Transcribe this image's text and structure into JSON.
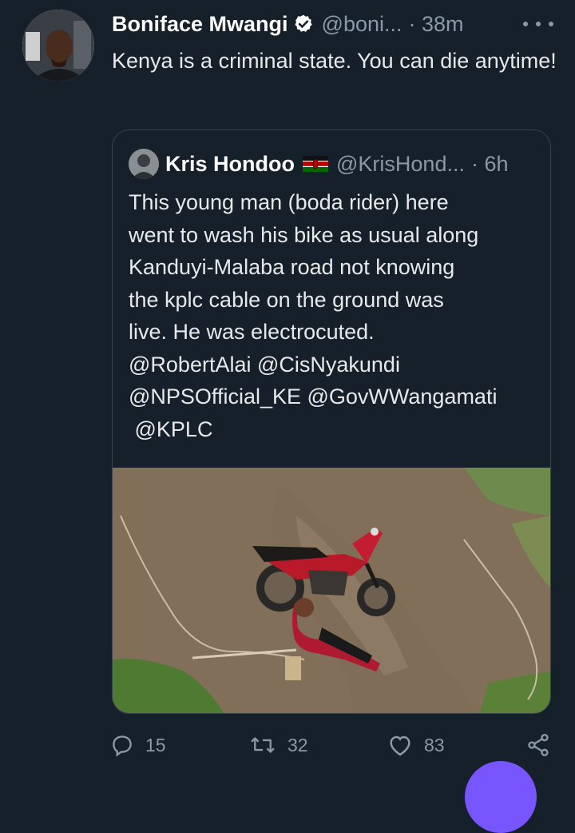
{
  "tweet": {
    "author_name": "Boniface Mwangi",
    "author_handle": "@boni...",
    "time": "· 38m",
    "text": "Kenya is a criminal state. You can die anytime!",
    "replies": "15",
    "retweets": "32",
    "likes": "83"
  },
  "quoted": {
    "author_name": "Kris Hondoo",
    "author_handle": "@KrisHond...",
    "time": "· 6h",
    "lines": [
      "This young man (boda rider) here",
      "went to wash his bike as usual along",
      "Kanduyi-Malaba road not knowing",
      "the kplc cable on the ground was",
      "live. He was electrocuted.",
      "@RobertAlai @CisNyakundi",
      "@NPSOfficial_KE @GovWWangamati",
      " @KPLC"
    ]
  },
  "icons": {
    "verified": "verified-badge-icon",
    "more": "more-options-icon",
    "flag": "kenya-flag-icon",
    "reply": "reply-icon",
    "retweet": "retweet-icon",
    "like": "heart-icon",
    "share": "share-icon"
  },
  "colors": {
    "background": "#15202b",
    "text": "#e7e9ea",
    "secondary_text": "#8b98a5",
    "border": "#38444d",
    "fab": "#7856ff"
  }
}
